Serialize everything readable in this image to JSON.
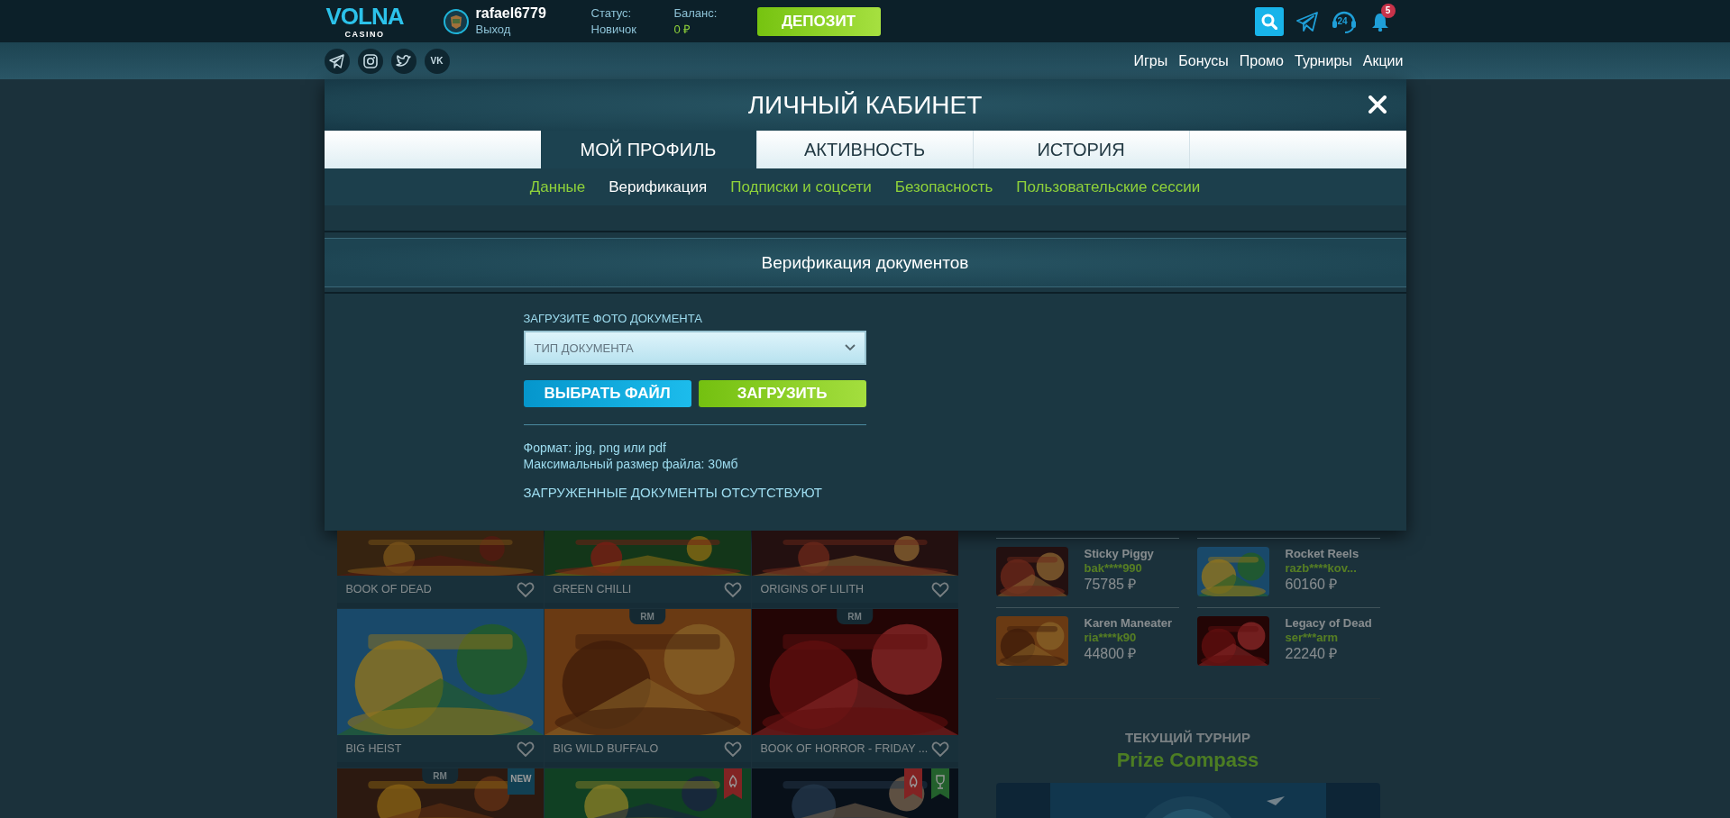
{
  "header": {
    "logo": {
      "name": "VOLNA",
      "sub": "CASINO"
    },
    "user": {
      "username": "rafael6779",
      "logout": "Выход"
    },
    "status": {
      "label": "Статус:",
      "value": "Новичок"
    },
    "balance": {
      "label": "Баланс:",
      "value": "0 ₽"
    },
    "deposit": "ДЕПОЗИТ",
    "support_label": "24",
    "notifications_count": "5"
  },
  "social": [
    {
      "kind": "telegram"
    },
    {
      "kind": "instagram"
    },
    {
      "kind": "twitter"
    },
    {
      "kind": "vk",
      "label": "VK"
    }
  ],
  "nav": {
    "links": [
      "Игры",
      "Бонусы",
      "Промо",
      "Турниры",
      "Акции"
    ]
  },
  "modal": {
    "title": "ЛИЧНЫЙ КАБИНЕТ",
    "tabs": [
      {
        "label": "МОЙ ПРОФИЛЬ",
        "selected": true
      },
      {
        "label": "АКТИВНОСТЬ",
        "selected": false
      },
      {
        "label": "ИСТОРИЯ",
        "selected": false
      }
    ],
    "subtabs": [
      {
        "label": "Данные",
        "selected": false
      },
      {
        "label": "Верификация",
        "selected": true
      },
      {
        "label": "Подписки и соцсети",
        "selected": false
      },
      {
        "label": "Безопасность",
        "selected": false
      },
      {
        "label": "Пользовательские сессии",
        "selected": false
      }
    ],
    "section_title": "Верификация документов",
    "upload_label": "ЗАГРУЗИТЕ ФОТО ДОКУМЕНТА",
    "document_type": {
      "placeholder": "ТИП ДОКУМЕНТА"
    },
    "buttons": [
      {
        "label": "ВЫБРАТЬ ФАЙЛ",
        "kind": "choose"
      },
      {
        "label": "ЗАГРУЗИТЬ",
        "kind": "upload"
      }
    ],
    "hints": [
      "Формат: jpg, png или pdf",
      "Максимальный размер файла: 30мб"
    ],
    "documents_status": "ЗАГРУЖЕННЫЕ ДОКУМЕНТЫ ОТСУТСТВУЮТ"
  },
  "games": [
    {
      "title": "BOOK OF DEAD"
    },
    {
      "title": "GREEN CHILLI"
    },
    {
      "title": "ORIGINS OF LILITH"
    },
    {
      "title": "BIG HEIST"
    },
    {
      "title": "BIG WILD BUFFALO",
      "badge": "RM"
    },
    {
      "title": "BOOK OF HORROR - FRIDAY ...",
      "badge": "RM"
    },
    {
      "badge": "RM",
      "ribbons": [
        {
          "kind": "new",
          "label": "NEW"
        }
      ]
    },
    {
      "ribbons": [
        {
          "kind": "fire"
        }
      ]
    },
    {
      "ribbons": [
        {
          "kind": "fire"
        },
        {
          "kind": "trophy"
        }
      ]
    }
  ],
  "winners": [
    {
      "game": "Sticky Piggy",
      "user": "bak****990",
      "amount": "75785 ₽"
    },
    {
      "game": "Rocket Reels",
      "user": "razb****kov...",
      "amount": "60160 ₽"
    },
    {
      "game": "Karen Maneater",
      "user": "ria****k90",
      "amount": "44800 ₽"
    },
    {
      "game": "Legacy of Dead",
      "user": "ser***arm",
      "amount": "22240 ₽"
    }
  ],
  "tournament": {
    "label": "ТЕКУЩИЙ ТУРНИР",
    "name": "Prize Compass"
  }
}
